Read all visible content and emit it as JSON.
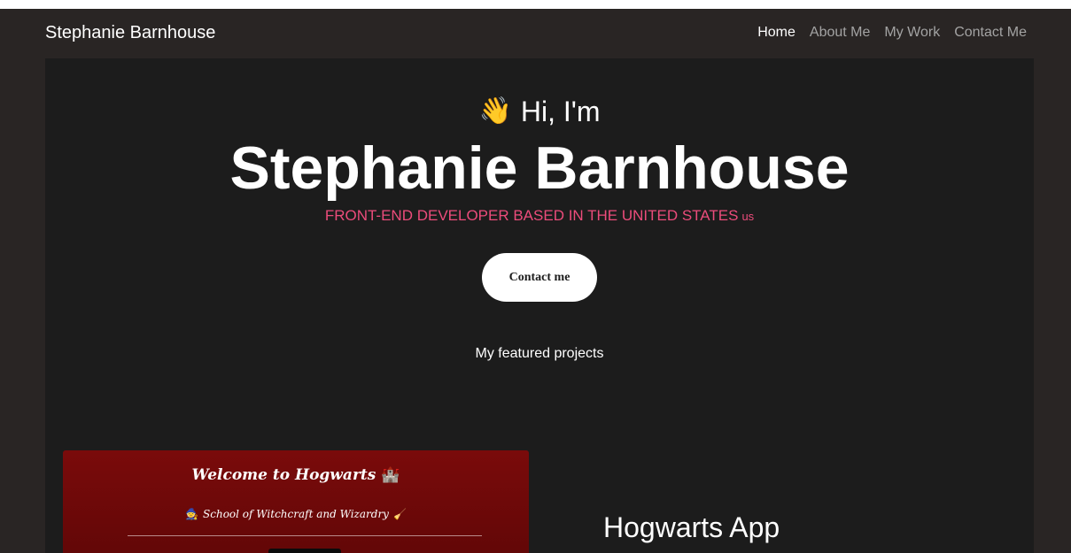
{
  "navbar": {
    "brand": "Stephanie Barnhouse",
    "links": [
      {
        "label": "Home"
      },
      {
        "label": "About Me"
      },
      {
        "label": "My Work"
      },
      {
        "label": "Contact Me"
      }
    ],
    "active_color": "#ffffff",
    "inactive_color": "#a3a3a3"
  },
  "hero": {
    "wave_icon": "👋",
    "greeting": "Hi, I'm",
    "name": "Stephanie Barnhouse",
    "tagline": "FRONT-END DEVELOPER BASED IN THE UNITED STATES",
    "flag": "us",
    "cta_label": "Contact me",
    "featured_heading": "My featured projects",
    "accent_color": "#ec4c7b"
  },
  "project": {
    "preview_title": "Welcome to Hogwarts",
    "preview_title_icon": "🏰",
    "preview_subtitle": "School of Witchcraft and Wizardry",
    "preview_subtitle_left_icon": "🧙",
    "preview_subtitle_right_icon": "🧹",
    "title": "Hogwarts App"
  }
}
